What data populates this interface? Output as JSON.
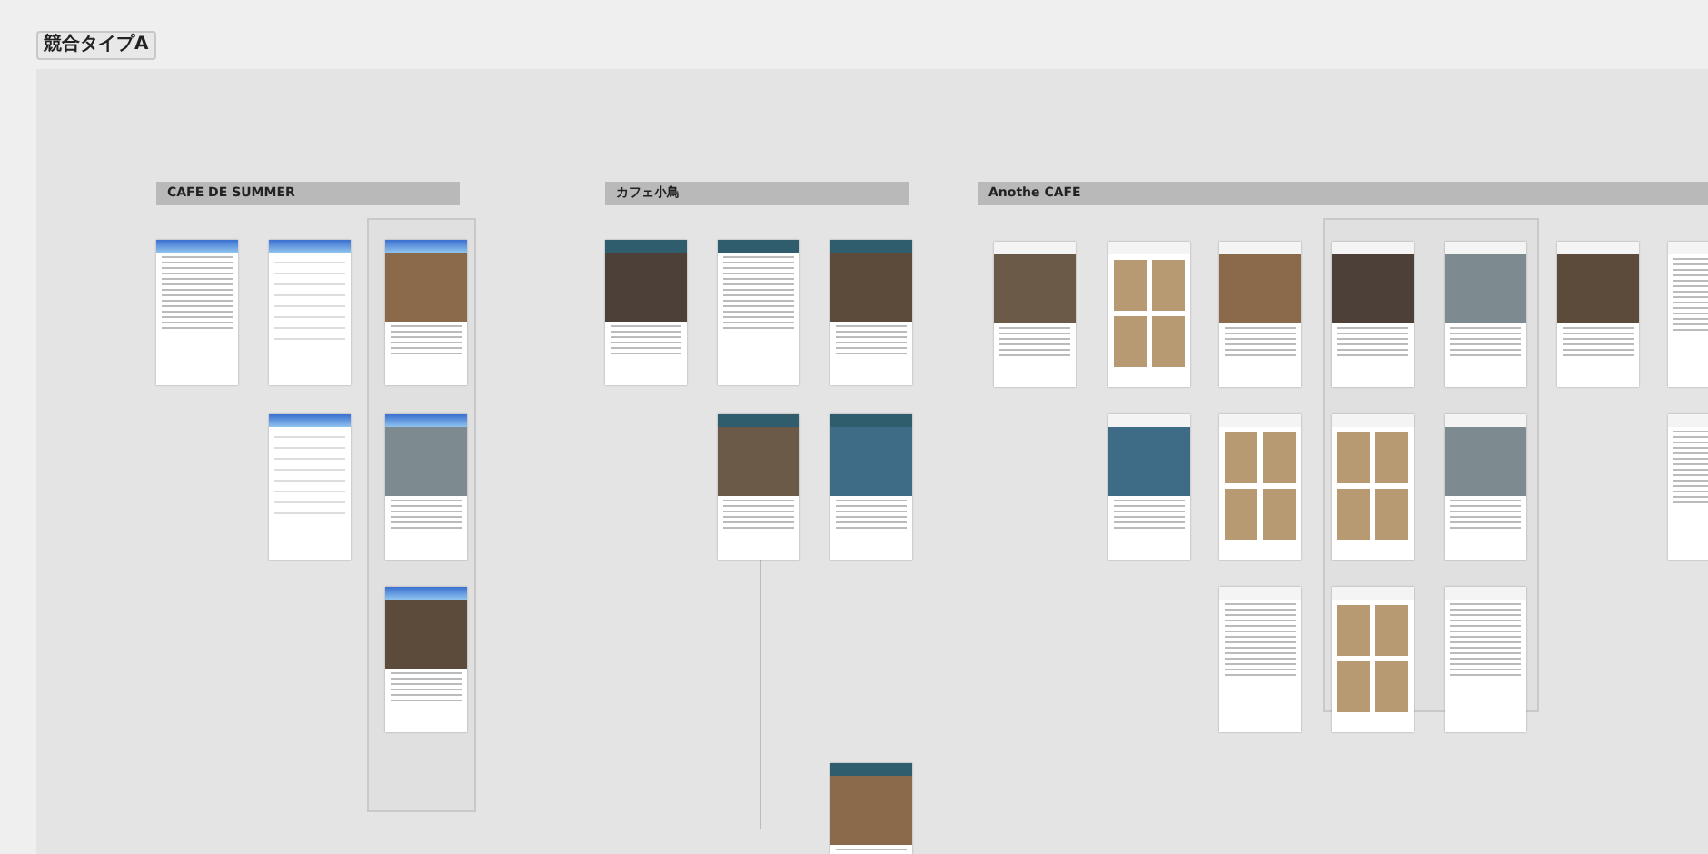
{
  "board": {
    "title": "競合タイプA"
  },
  "sections": [
    {
      "title": "CAFE DE SUMMER",
      "frames": [
        {
          "kind": "text"
        },
        {
          "kind": "menu"
        },
        {
          "kind": "photo"
        },
        {
          "kind": "menu"
        },
        {
          "kind": "photo"
        },
        {
          "kind": "photo"
        }
      ]
    },
    {
      "title": "カフェ小鳥",
      "frames": [
        {
          "kind": "photo"
        },
        {
          "kind": "text"
        },
        {
          "kind": "photo"
        },
        {
          "kind": "photo"
        },
        {
          "kind": "photo"
        },
        {
          "kind": "photo"
        }
      ]
    },
    {
      "title": "Anothe CAFE",
      "frames": [
        {
          "kind": "photo"
        },
        {
          "kind": "grid"
        },
        {
          "kind": "photo"
        },
        {
          "kind": "photo"
        },
        {
          "kind": "photo"
        },
        {
          "kind": "photo"
        },
        {
          "kind": "text"
        },
        {
          "kind": "photo"
        },
        {
          "kind": "grid"
        },
        {
          "kind": "grid"
        },
        {
          "kind": "photo"
        },
        {
          "kind": "text"
        },
        {
          "kind": "text"
        },
        {
          "kind": "grid"
        },
        {
          "kind": "text"
        }
      ]
    }
  ]
}
